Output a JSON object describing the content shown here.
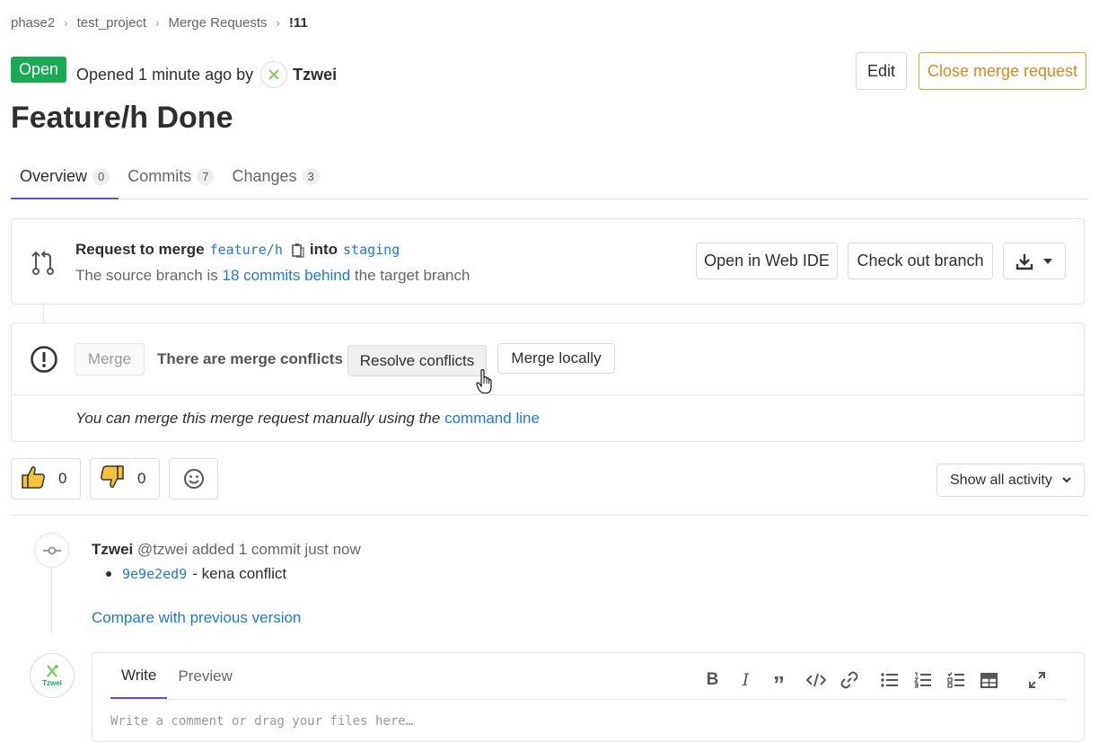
{
  "breadcrumb": {
    "items": [
      "phase2",
      "test_project",
      "Merge Requests",
      "!11"
    ]
  },
  "header": {
    "status": "Open",
    "opened_prefix": "Opened 1 minute ago by",
    "author": "Tzwei",
    "edit_label": "Edit",
    "close_label": "Close merge request",
    "title": "Feature/h Done"
  },
  "tabs": [
    {
      "label": "Overview",
      "count": "0"
    },
    {
      "label": "Commits",
      "count": "7"
    },
    {
      "label": "Changes",
      "count": "3"
    }
  ],
  "source": {
    "request_to_merge": "Request to merge",
    "source_branch": "feature/h",
    "into": "into",
    "target_branch": "staging",
    "behind_prefix": "The source branch is",
    "behind_link": "18 commits behind",
    "behind_suffix": "the target branch",
    "web_ide_label": "Open in Web IDE",
    "checkout_label": "Check out branch"
  },
  "widget": {
    "merge_label": "Merge",
    "conflict_text": "There are merge conflicts",
    "resolve_label": "Resolve conflicts",
    "merge_locally_label": "Merge locally",
    "manual_prefix": "You can merge this merge request manually using the",
    "manual_link": "command line"
  },
  "awards": {
    "thumbs_up_count": "0",
    "thumbs_down_count": "0",
    "activity_filter": "Show all activity"
  },
  "timeline": {
    "author": "Tzwei",
    "action": "@tzwei added 1 commit just now",
    "commit_sha": "9e9e2ed9",
    "commit_message": "- kena conflict",
    "compare_link": "Compare with previous version"
  },
  "comment": {
    "avatar_text": "Tzwei",
    "write_tab": "Write",
    "preview_tab": "Preview",
    "placeholder": "Write a comment or drag your files here…"
  },
  "colors": {
    "accent": "#6b4fbb",
    "status_open": "#1aaa55",
    "link": "#1f78d1",
    "warning": "#e0a33a"
  }
}
